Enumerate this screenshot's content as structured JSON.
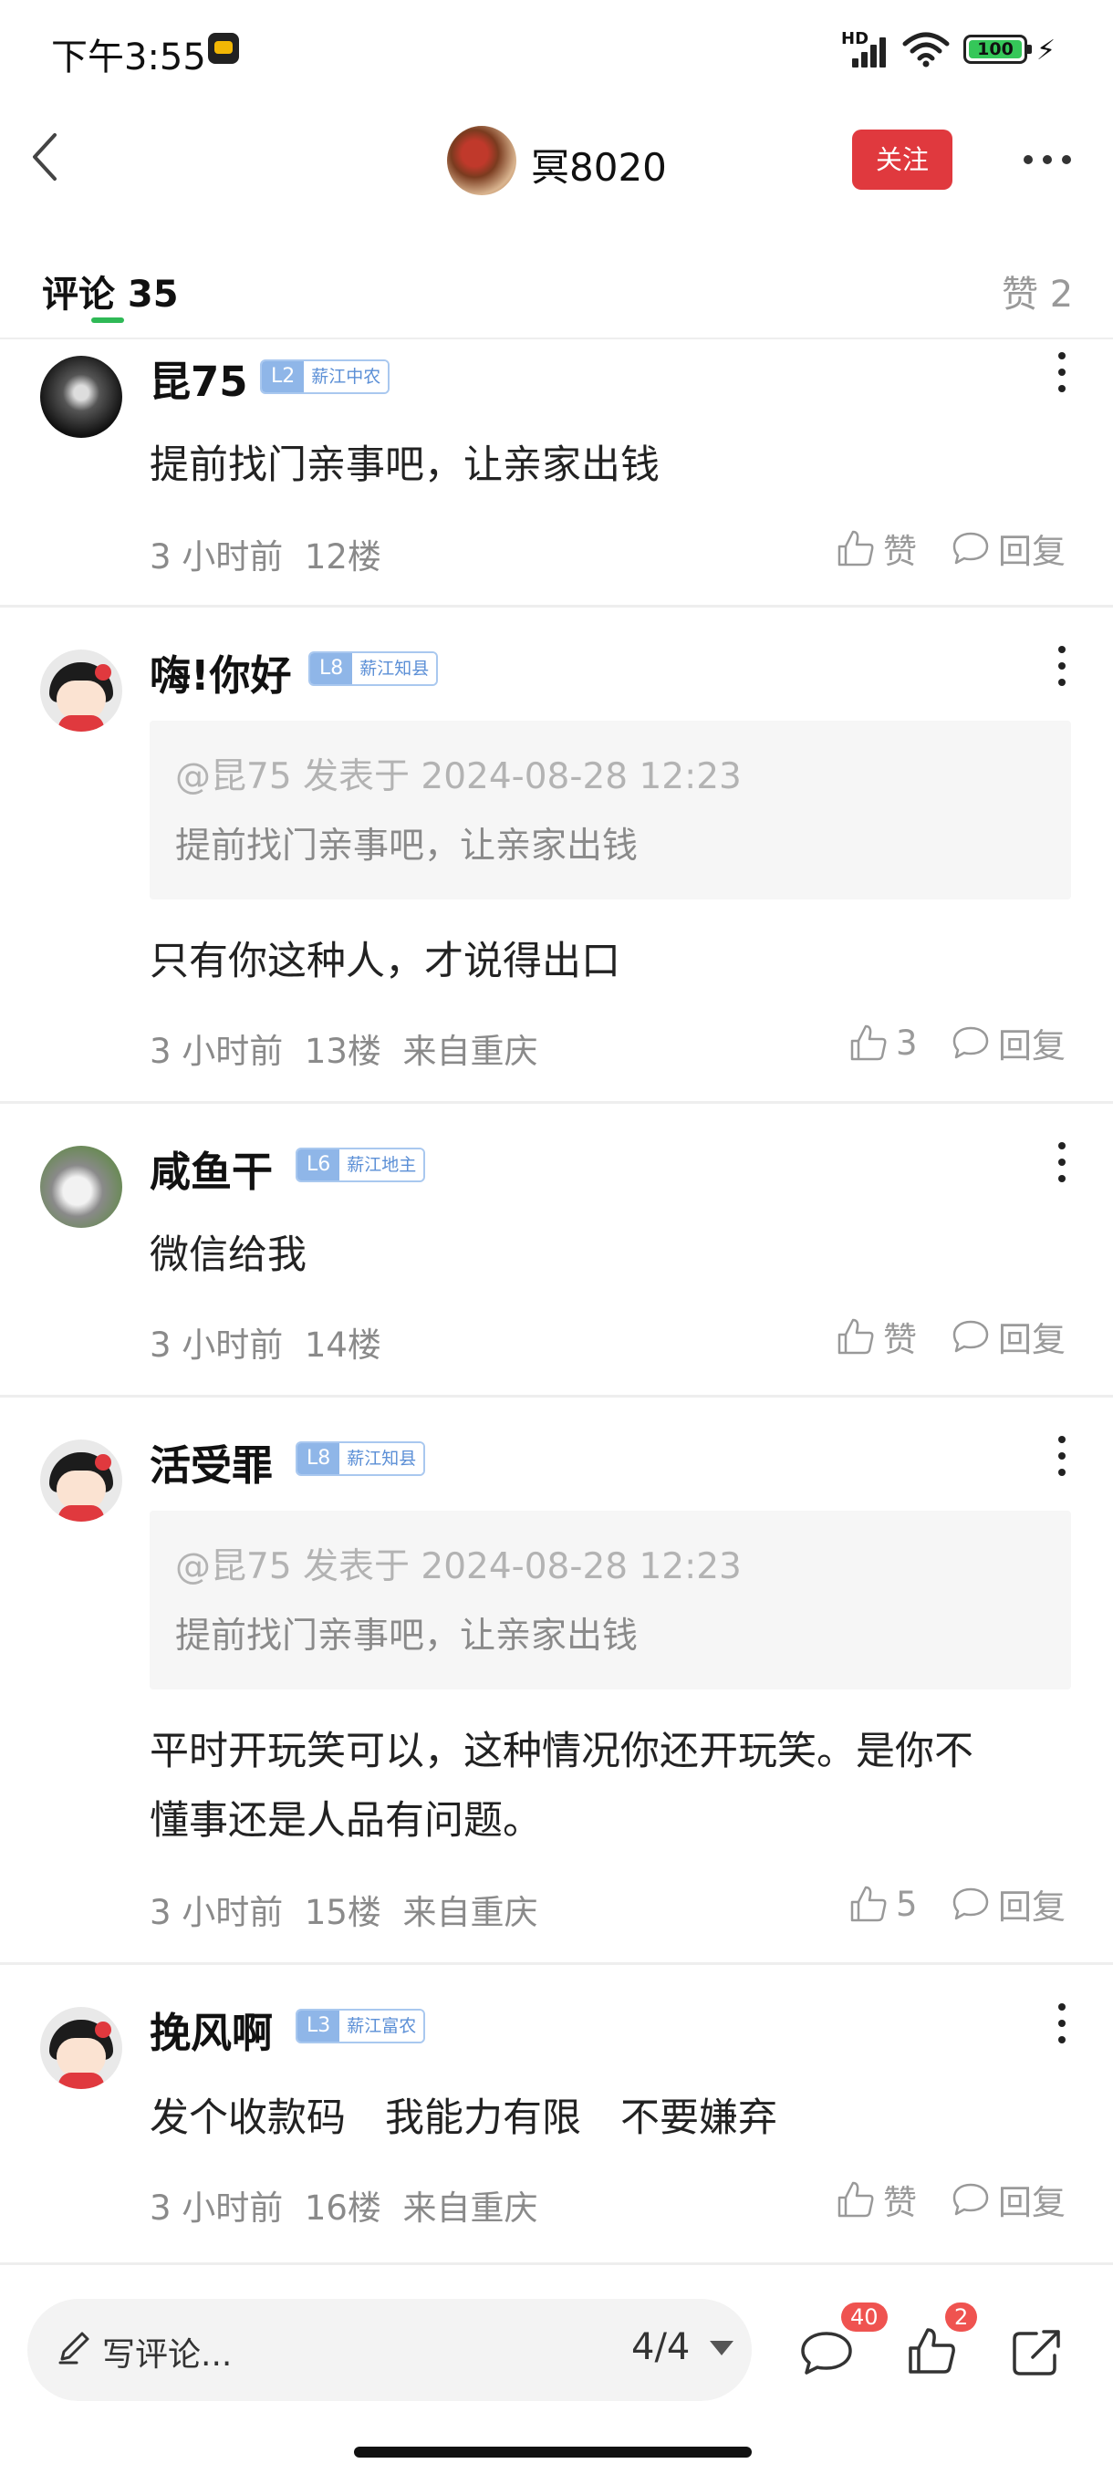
{
  "status_bar": {
    "time": "下午3:55",
    "network": "HD",
    "battery": "100"
  },
  "header": {
    "author_name": "冥8020",
    "follow_label": "关注"
  },
  "tabs": {
    "comments_label": "评论 35",
    "likes_label": "赞 2"
  },
  "comments": [
    {
      "username": "昆75",
      "level": "L2",
      "title": "薪江中农",
      "text": "提前找门亲事吧，让亲家出钱",
      "time": "3 小时前",
      "floor": "12楼",
      "location": "",
      "like_label": "赞",
      "reply_label": "回复"
    },
    {
      "username": "嗨!你好",
      "level": "L8",
      "title": "薪江知县",
      "quote_header": "@昆75 发表于 2024-08-28 12:23",
      "quote_body": "提前找门亲事吧，让亲家出钱",
      "text": "只有你这种人，才说得出口",
      "time": "3 小时前",
      "floor": "13楼",
      "location": "来自重庆",
      "like_label": "3",
      "reply_label": "回复"
    },
    {
      "username": "咸鱼干",
      "level": "L6",
      "title": "薪江地主",
      "text": "微信给我",
      "time": "3 小时前",
      "floor": "14楼",
      "location": "",
      "like_label": "赞",
      "reply_label": "回复"
    },
    {
      "username": "活受罪",
      "level": "L8",
      "title": "薪江知县",
      "quote_header": "@昆75 发表于 2024-08-28 12:23",
      "quote_body": "提前找门亲事吧，让亲家出钱",
      "text_line1": "平时开玩笑可以，这种情况你还开玩笑。是你不",
      "text_line2": "懂事还是人品有问题。",
      "time": "3 小时前",
      "floor": "15楼",
      "location": "来自重庆",
      "like_label": "5",
      "reply_label": "回复"
    },
    {
      "username": "挽风啊",
      "level": "L3",
      "title": "薪江富农",
      "text": "发个收款码　我能力有限　不要嫌弃",
      "time": "3 小时前",
      "floor": "16楼",
      "location": "来自重庆",
      "like_label": "赞",
      "reply_label": "回复"
    }
  ],
  "bottom_bar": {
    "write_placeholder": "写评论...",
    "page_indicator": "4/4",
    "comment_badge": "40",
    "like_badge": "2"
  },
  "colors": {
    "follow": "#e0393e",
    "tab_accent": "#2fb956",
    "level_badge": "#8fb6e8",
    "badge": "#ef5350"
  }
}
